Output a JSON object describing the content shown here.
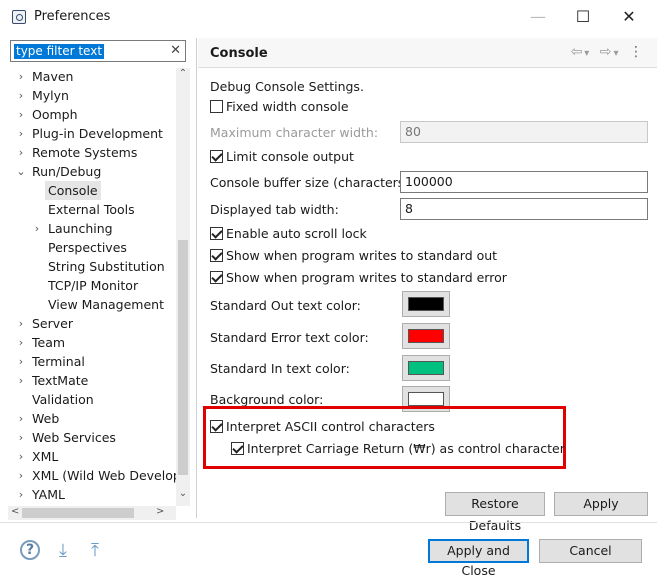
{
  "window": {
    "title": "Preferences",
    "minimize": "—",
    "maximize": "☐",
    "close": "✕"
  },
  "filter": {
    "text": "type filter text",
    "clear": "✕"
  },
  "tree": {
    "items": [
      {
        "label": "Maven",
        "chev": "›"
      },
      {
        "label": "Mylyn",
        "chev": "›"
      },
      {
        "label": "Oomph",
        "chev": "›"
      },
      {
        "label": "Plug-in Development",
        "chev": "›"
      },
      {
        "label": "Remote Systems",
        "chev": "›"
      },
      {
        "label": "Run/Debug",
        "chev": "⌄"
      },
      {
        "label": "Console",
        "chev": ""
      },
      {
        "label": "External Tools",
        "chev": ""
      },
      {
        "label": "Launching",
        "chev": "›"
      },
      {
        "label": "Perspectives",
        "chev": ""
      },
      {
        "label": "String Substitution",
        "chev": ""
      },
      {
        "label": "TCP/IP Monitor",
        "chev": ""
      },
      {
        "label": "View Management",
        "chev": ""
      },
      {
        "label": "Server",
        "chev": "›"
      },
      {
        "label": "Team",
        "chev": "›"
      },
      {
        "label": "Terminal",
        "chev": "›"
      },
      {
        "label": "TextMate",
        "chev": "›"
      },
      {
        "label": "Validation",
        "chev": ""
      },
      {
        "label": "Web",
        "chev": "›"
      },
      {
        "label": "Web Services",
        "chev": "›"
      },
      {
        "label": "XML",
        "chev": "›"
      },
      {
        "label": "XML (Wild Web Developer)",
        "chev": "›"
      },
      {
        "label": "YAML",
        "chev": "›"
      }
    ],
    "selected": "Console"
  },
  "scroll": {
    "up": "⌃",
    "down": "⌄",
    "left": "<",
    "right": ">"
  },
  "header": {
    "title": "Console",
    "back": "⇦",
    "back_menu": "▾",
    "forward": "⇨",
    "forward_menu": "▾",
    "menu": "⋮"
  },
  "settings": {
    "section_label": "Debug Console Settings.",
    "fixed_width_label": "Fixed width console",
    "fixed_width_checked": false,
    "max_char_width_label": "Maximum character width:",
    "max_char_width_value": "80",
    "limit_output_label": "Limit console output",
    "limit_output_checked": true,
    "buffer_size_label": "Console buffer size (characters):",
    "buffer_size_value": "100000",
    "tab_width_label": "Displayed tab width:",
    "tab_width_value": "8",
    "auto_scroll_label": "Enable auto scroll lock",
    "auto_scroll_checked": true,
    "show_stdout_label": "Show when program writes to standard out",
    "show_stdout_checked": true,
    "show_stderr_label": "Show when program writes to standard error",
    "show_stderr_checked": true,
    "stdout_color_label": "Standard Out text color:",
    "stderr_color_label": "Standard Error text color:",
    "stdin_color_label": "Standard In text color:",
    "background_color_label": "Background color:",
    "interpret_ascii_label": "Interpret ASCII control characters",
    "interpret_ascii_checked": true,
    "interpret_cr_label": "Interpret Carriage Return (₩r) as control character",
    "interpret_cr_checked": true
  },
  "colors": {
    "stdout": "#000000",
    "stderr": "#ff0000",
    "stdin": "#00c080",
    "background": "#ffffff"
  },
  "buttons": {
    "restore_defaults": "Restore Defaults",
    "apply": "Apply",
    "apply_and_close": "Apply and Close",
    "cancel": "Cancel"
  },
  "footer": {
    "help_icon": "?",
    "import_icon": "⤓",
    "export_icon": "⤒"
  }
}
